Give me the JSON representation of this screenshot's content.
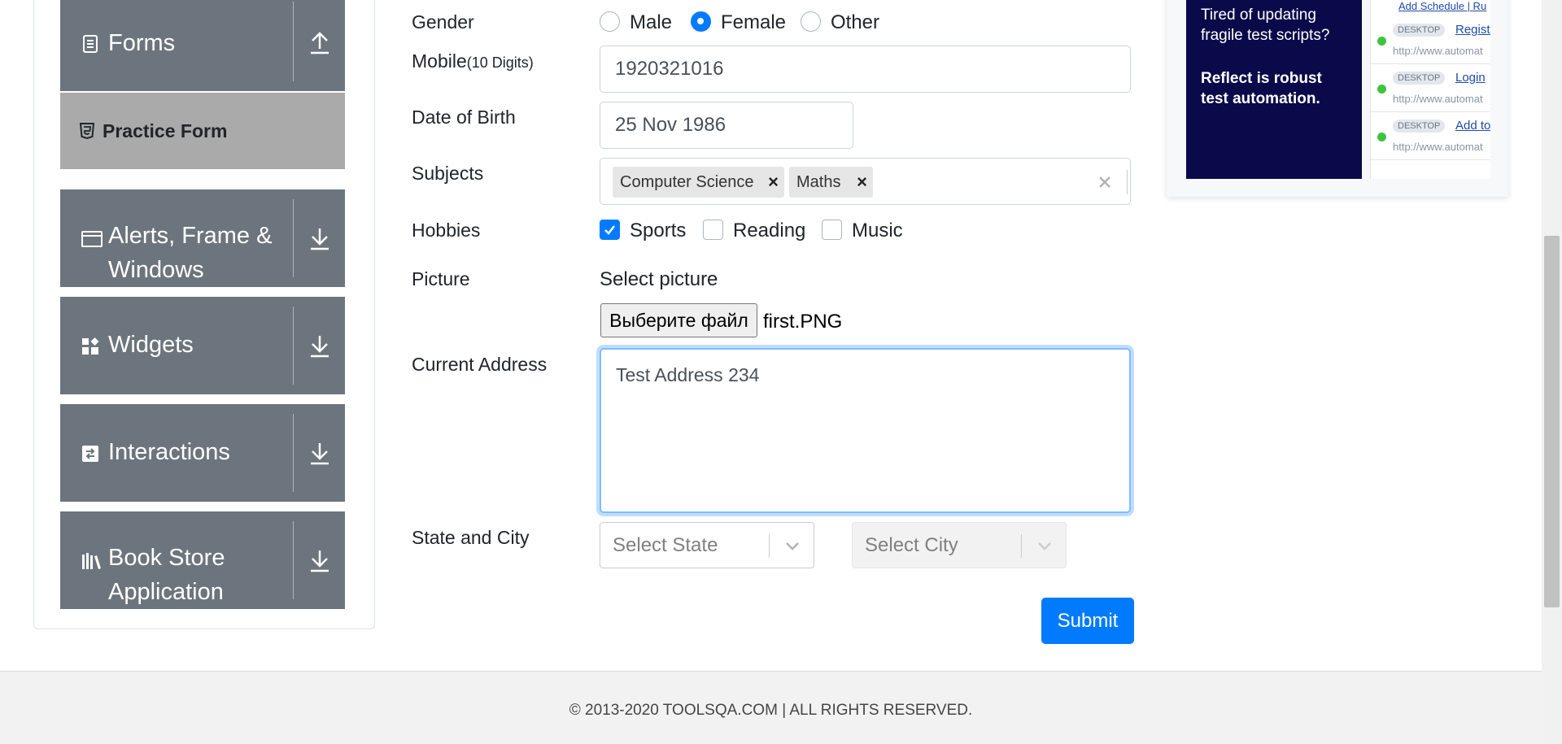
{
  "sidebar": {
    "forms_label": "Forms",
    "practice_form_label": "Practice Form",
    "alerts_label": "Alerts, Frame & Windows",
    "widgets_label": "Widgets",
    "interactions_label": "Interactions",
    "bookstore_label": "Book Store Application"
  },
  "form": {
    "gender_label": "Gender",
    "gender_options": [
      "Male",
      "Female",
      "Other"
    ],
    "gender_selected": "Female",
    "mobile_label": "Mobile",
    "mobile_hint": "(10 Digits)",
    "mobile_value": "1920321016",
    "dob_label": "Date of Birth",
    "dob_value": "25 Nov 1986",
    "subjects_label": "Subjects",
    "subjects": [
      "Computer Science",
      "Maths"
    ],
    "hobbies_label": "Hobbies",
    "hobbies": [
      "Sports",
      "Reading",
      "Music"
    ],
    "hobbies_checked": [
      "Sports"
    ],
    "picture_label": "Picture",
    "picture_select_text": "Select picture",
    "file_button_label": "Выберите файл",
    "file_name": "first.PNG",
    "address_label": "Current Address",
    "address_value": "Test Address 234",
    "state_city_label": "State and City",
    "state_placeholder": "Select State",
    "city_placeholder": "Select City",
    "submit_label": "Submit"
  },
  "ad": {
    "text1": "Tired of updating fragile test scripts?",
    "text2": "Reflect is robust test automation.",
    "top_links": "Add Schedule | Ru",
    "rows": [
      {
        "badge": "DESKTOP",
        "link": "Registr",
        "url": "http://www.automat"
      },
      {
        "badge": "DESKTOP",
        "link": "Login",
        "url": "http://www.automat"
      },
      {
        "badge": "DESKTOP",
        "link": "Add to",
        "url": "http://www.automat"
      }
    ]
  },
  "footer": {
    "text": "© 2013-2020 TOOLSQA.COM | ALL RIGHTS RESERVED."
  },
  "colors": {
    "primary": "#007bff",
    "sidebar_group": "#6c757d",
    "practice_active": "#aaaaaa",
    "ad_dark": "#0a0a4a"
  }
}
